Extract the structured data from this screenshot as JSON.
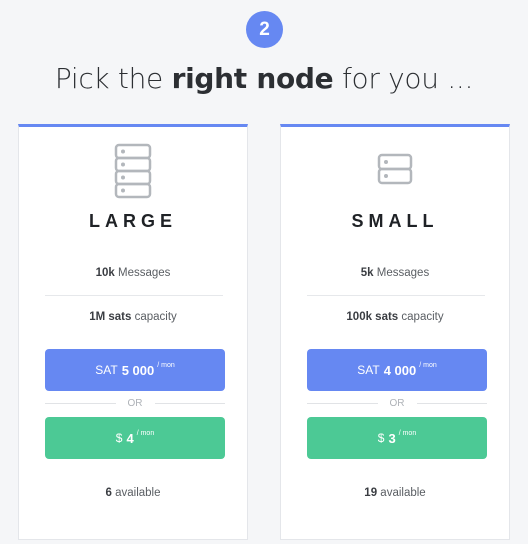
{
  "step": {
    "number": "2"
  },
  "heading": {
    "prefix": "Pick the",
    "bold": "right node",
    "suffix": "for you ..."
  },
  "cards": [
    {
      "name": "LARGE",
      "icon": "server-rack-large-icon",
      "messages_value": "10k",
      "messages_label": "Messages",
      "capacity_value": "1M sats",
      "capacity_label": "capacity",
      "sat_prefix": "SAT",
      "sat_price": "5 000",
      "sat_per": "/ mon",
      "or_label": "OR",
      "usd_prefix": "$",
      "usd_price": "4",
      "usd_per": "/ mon",
      "available_count": "6",
      "available_label": "available"
    },
    {
      "name": "SMALL",
      "icon": "server-rack-small-icon",
      "messages_value": "5k",
      "messages_label": "Messages",
      "capacity_value": "100k sats",
      "capacity_label": "capacity",
      "sat_prefix": "SAT",
      "sat_price": "4 000",
      "sat_per": "/ mon",
      "or_label": "OR",
      "usd_prefix": "$",
      "usd_price": "3",
      "usd_per": "/ mon",
      "available_count": "19",
      "available_label": "available"
    }
  ],
  "colors": {
    "accent": "#6688f2",
    "green": "#4cc995",
    "background": "#f5f6f8"
  }
}
